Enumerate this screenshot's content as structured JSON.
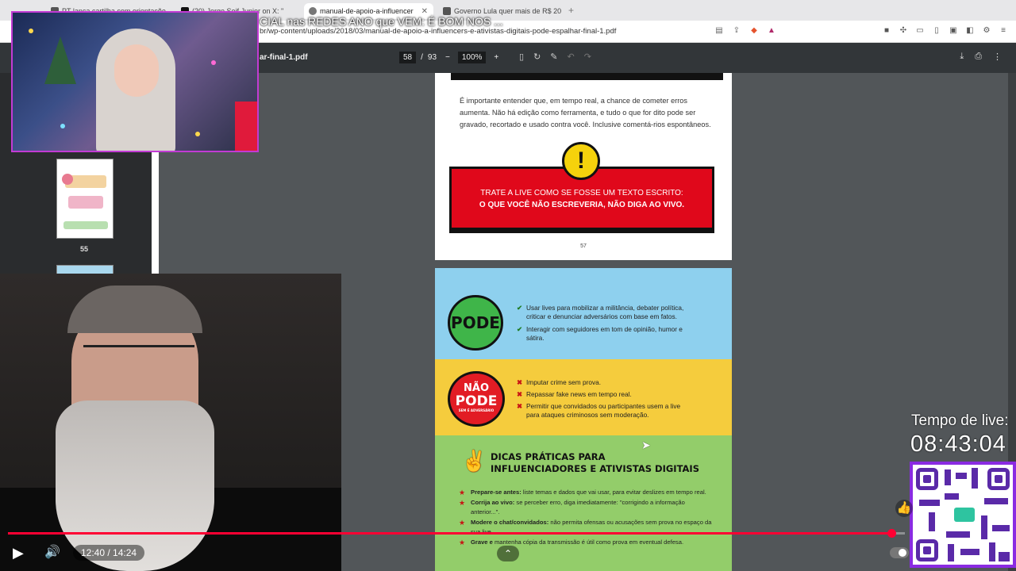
{
  "browser": {
    "tabs": [
      {
        "label": "PT lança cartilha com orientaçõe",
        "active": false
      },
      {
        "label": "(20) Jorge Seif Junior on X: \"",
        "active": false
      },
      {
        "label": "manual-de-apoio-a-influencer",
        "active": true
      },
      {
        "label": "Governo Lula quer mais de R$ 20",
        "active": false
      }
    ],
    "new_tab": "+",
    "overlay_title": "CIAL nas REDES ANO que VEM: É BOM NOS ...",
    "url": "br/wp-content/uploads/2018/03/manual-de-apoio-a-influencers-e-ativistas-digitais-pode-espalhar-final-1.pdf"
  },
  "pdf_toolbar": {
    "filename": "ar-final-1.pdf",
    "current_page": "58",
    "total_pages": "93",
    "zoom": "100%",
    "zoom_out": "−",
    "zoom_in": "+"
  },
  "sidebar": {
    "thumb_label": "55"
  },
  "page57": {
    "paragraph": "É importante entender que, em tempo real, a chance de cometer erros aumenta. Não há edição como ferramenta, e tudo o que for dito pode ser gravado, recortado e usado contra você. Inclusive comentá-rios espontâneos.",
    "warning_symbol": "!",
    "callout_line1": "TRATE A LIVE COMO SE FOSSE UM TEXTO ESCRITO:",
    "callout_line2": "O QUE VOCÊ NÃO ESCREVERIA, NÃO DIGA AO VIVO.",
    "page_number": "57"
  },
  "page58": {
    "pode_badge": "PODE",
    "pode_items": [
      "Usar lives para mobilizar a militância, debater política, criticar e denunciar adversários com base em fatos.",
      "Interagir com seguidores em tom de opinião, humor e sátira."
    ],
    "naopode_badge_line1": "NÃO",
    "naopode_badge_line2": "PODE",
    "naopode_badge_line3": "SEM É ADVERSÁRIO",
    "naopode_items": [
      "Imputar crime sem prova.",
      "Repassar fake news em tempo real.",
      "Permitir que convidados ou participantes usem a live para ataques criminosos sem moderação."
    ],
    "tips_title_line1": "DICAS PRÁTICAS PARA",
    "tips_title_line2": "INFLUENCIADORES E ATIVISTAS DIGITAIS",
    "tips": [
      {
        "bold": "Prepare-se antes:",
        "text": " liste temas e dados que vai usar, para evitar deslizes em tempo real."
      },
      {
        "bold": "Corrija ao vivo:",
        "text": " se perceber erro, diga imediatamente: \"corrigindo a informação anterior...\"."
      },
      {
        "bold": "Modere o chat/convidados:",
        "text": " não permita ofensas ou acusações sem prova no espaço da sua live."
      },
      {
        "bold": "Grave e ",
        "text": "mantenha cópia da transmissão é útil como prova em eventual defesa."
      }
    ]
  },
  "video": {
    "time": "12:40 / 14:24",
    "progress": 0.985
  },
  "overlay": {
    "live_label": "Tempo de live:",
    "live_time": "08:43:04"
  },
  "colors": {
    "callout_red": "#e0081b",
    "pode_green": "#3fb549",
    "progress_red": "#ff0033",
    "qr_purple": "#5a2aa8"
  },
  "icons": [
    "play-icon",
    "volume-icon",
    "warning-icon",
    "check-icon",
    "cross-icon",
    "star-icon",
    "hand-icon",
    "download-icon",
    "print-icon",
    "more-icon",
    "like-icon",
    "chevron-up-icon"
  ]
}
